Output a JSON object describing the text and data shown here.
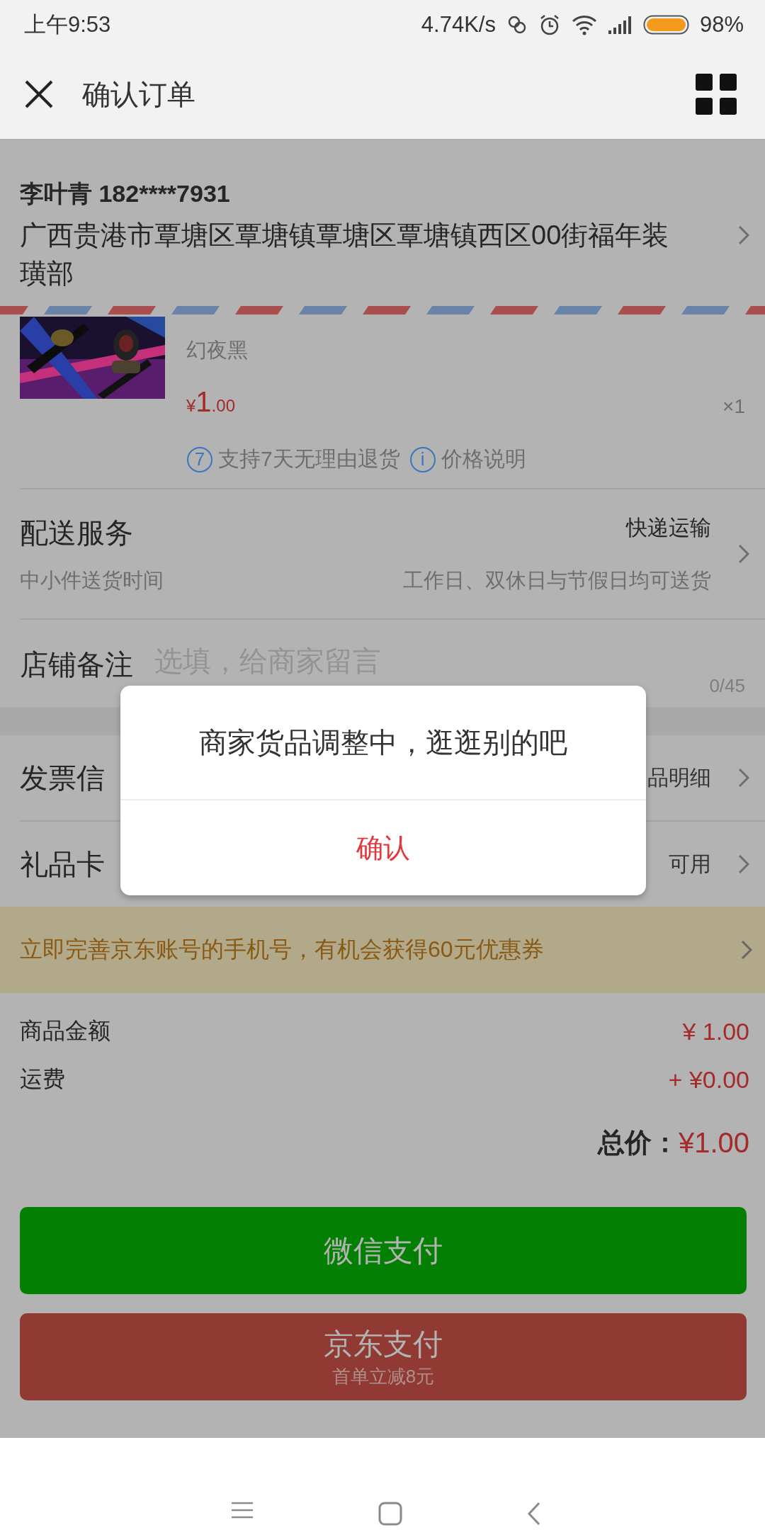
{
  "status_bar": {
    "time": "上午9:53",
    "speed": "4.74K/s",
    "battery": "98%"
  },
  "header": {
    "title": "确认订单"
  },
  "address": {
    "name": "李叶青 182****7931",
    "text": "广西贵港市覃塘区覃塘镇覃塘区覃塘镇西区00街福年装璜部"
  },
  "product": {
    "variant": "幻夜黑",
    "price_symbol": "¥",
    "price_int": "1",
    "price_dec": ".00",
    "quantity": "×1",
    "tags": [
      {
        "icon": "7",
        "label": "支持7天无理由退货"
      },
      {
        "icon": "i",
        "label": "价格说明"
      }
    ]
  },
  "delivery": {
    "label": "配送服务",
    "value": "快递运输",
    "note": "中小件送货时间",
    "detail": "工作日、双休日与节假日均可送货"
  },
  "remark": {
    "label": "店铺备注",
    "placeholder": "选填，给商家留言",
    "counter": "0/45"
  },
  "rows": [
    {
      "label": "发票信",
      "value": "品明细"
    },
    {
      "label": "礼品卡",
      "value": "可用"
    }
  ],
  "promo": {
    "text": "立即完善京东账号的手机号，有机会获得60元优惠券"
  },
  "summary": [
    {
      "label": "商品金额",
      "value": "¥ 1.00"
    },
    {
      "label": "运费",
      "value": "+ ¥0.00"
    }
  ],
  "total": {
    "label": "总价：",
    "value": "¥1.00"
  },
  "pay_buttons": [
    {
      "kind": "wechat",
      "label": "微信支付"
    },
    {
      "kind": "jd",
      "label": "京东支付",
      "note": "首单立减8元"
    }
  ],
  "dialog": {
    "message": "商家货品调整中，逛逛别的吧",
    "button": "确认"
  }
}
